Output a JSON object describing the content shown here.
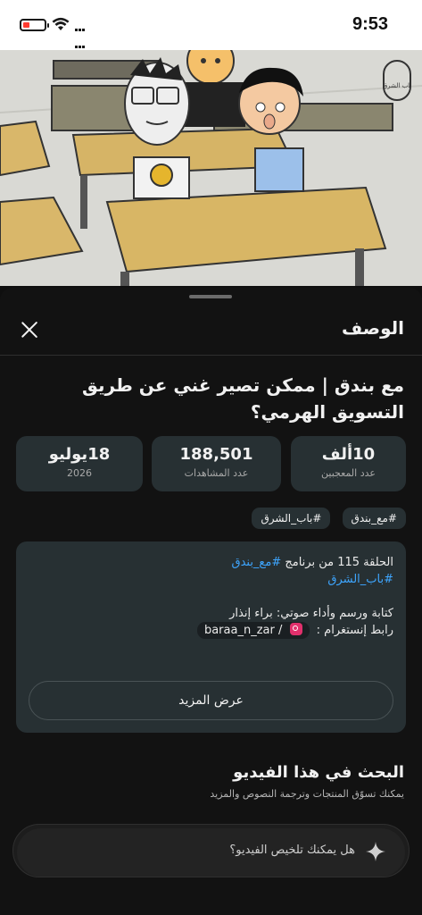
{
  "status_bar": {
    "time": "9:53",
    "icons": [
      "battery-low-icon",
      "wifi-icon",
      "grid-icon"
    ],
    "battery_color": "#ff3b30"
  },
  "video": {
    "watermark_text": "باب الشرق"
  },
  "sheet": {
    "title": "الوصف",
    "close_icon": "close-icon"
  },
  "video_info": {
    "title": "مع بندق | ممكن تصير غني عن طريق التسويق الهرمي؟",
    "stats": {
      "likes_value": "10ألف",
      "likes_label": "عدد المعجبين",
      "views_value": "188,501",
      "views_label": "عدد المشاهدات",
      "date_value": "18يوليو",
      "date_year": "2026"
    },
    "tags": [
      "#مع_بندق",
      "#باب_الشرق"
    ]
  },
  "description": {
    "line1_prefix": "الحلقة 115 من برنامج",
    "line1_link": "#مع_بندق",
    "line2_link": "#باب_الشرق",
    "credits": "كتابة ورسم وأداء صوتي: براء إنذار",
    "instagram_label": "رابط إنستغرام :",
    "instagram_handle": "baraa_n_zar /",
    "show_more": "عرض المزيد"
  },
  "search": {
    "title": "البحث في هذا الفيديو",
    "subtitle": "يمكنك تسوّق المنتجات وترجمة النصوص والمزيد",
    "ask_placeholder": "هل يمكنك تلخيص الفيديو؟"
  },
  "colors": {
    "background": "#121212",
    "card": "#273033",
    "link": "#3ea6ff"
  }
}
